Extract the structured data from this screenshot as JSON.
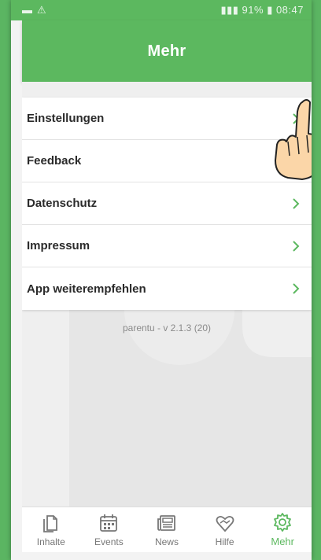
{
  "colors": {
    "accent": "#5cb85f",
    "text": "#2a2a2a",
    "muted": "#777777"
  },
  "statusbar": {
    "left_icons": [
      "message-icon",
      "warning-icon"
    ],
    "time": "08:47",
    "battery": "91%"
  },
  "appbar": {
    "title": "Mehr"
  },
  "menu": {
    "items": [
      {
        "label": "Einstellungen"
      },
      {
        "label": "Feedback"
      },
      {
        "label": "Datenschutz"
      },
      {
        "label": "Impressum"
      },
      {
        "label": "App weiterempfehlen"
      }
    ]
  },
  "version": "parentu - v 2.1.3 (20)",
  "tabs": [
    {
      "label": "Inhalte",
      "icon": "documents-icon",
      "active": false
    },
    {
      "label": "Events",
      "icon": "calendar-icon",
      "active": false
    },
    {
      "label": "News",
      "icon": "newspaper-icon",
      "active": false
    },
    {
      "label": "Hilfe",
      "icon": "heart-hands-icon",
      "active": false
    },
    {
      "label": "Mehr",
      "icon": "gear-icon",
      "active": true
    }
  ]
}
